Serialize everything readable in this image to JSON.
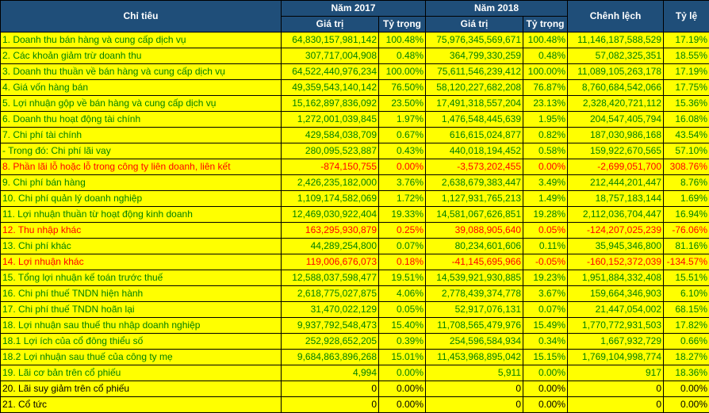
{
  "header": {
    "chi_tieu": "Chỉ tiêu",
    "year_2017": "Năm 2017",
    "year_2018": "Năm 2018",
    "chenh_lech": "Chênh lệch",
    "ty_le": "Tỷ lệ",
    "gia_tri": "Giá trị",
    "ty_trong": "Tỷ trọng"
  },
  "rows": [
    {
      "label": "1. Doanh thu bán hàng và cung cấp dịch vụ",
      "v2017": "64,830,157,981,142",
      "t2017": "100.48%",
      "v2018": "75,976,345,569,671",
      "t2018": "100.48%",
      "diff": "11,146,187,588,529",
      "rate": "17.19%",
      "color": "green"
    },
    {
      "label": "2. Các khoản giảm trừ doanh thu",
      "v2017": "307,717,004,908",
      "t2017": "0.48%",
      "v2018": "364,799,330,259",
      "t2018": "0.48%",
      "diff": "57,082,325,351",
      "rate": "18.55%",
      "color": "green"
    },
    {
      "label": "3. Doanh thu thuần về bán hàng và cung cấp dịch vụ",
      "v2017": "64,522,440,976,234",
      "t2017": "100.00%",
      "v2018": "75,611,546,239,412",
      "t2018": "100.00%",
      "diff": "11,089,105,263,178",
      "rate": "17.19%",
      "color": "green"
    },
    {
      "label": "4. Giá vốn hàng bán",
      "v2017": "49,359,543,140,142",
      "t2017": "76.50%",
      "v2018": "58,120,227,682,208",
      "t2018": "76.87%",
      "diff": "8,760,684,542,066",
      "rate": "17.75%",
      "color": "green"
    },
    {
      "label": "5. Lợi nhuận gộp về bán hàng và cung cấp dịch vụ",
      "v2017": "15,162,897,836,092",
      "t2017": "23.50%",
      "v2018": "17,491,318,557,204",
      "t2018": "23.13%",
      "diff": "2,328,420,721,112",
      "rate": "15.36%",
      "color": "green"
    },
    {
      "label": "6. Doanh thu hoạt động tài chính",
      "v2017": "1,272,001,039,845",
      "t2017": "1.97%",
      "v2018": "1,476,548,445,639",
      "t2018": "1.95%",
      "diff": "204,547,405,794",
      "rate": "16.08%",
      "color": "green"
    },
    {
      "label": "7. Chi phí tài chính",
      "v2017": "429,584,038,709",
      "t2017": "0.67%",
      "v2018": "616,615,024,877",
      "t2018": "0.82%",
      "diff": "187,030,986,168",
      "rate": "43.54%",
      "color": "green"
    },
    {
      "label": " - Trong đó: Chi phí lãi vay",
      "v2017": "280,095,523,887",
      "t2017": "0.43%",
      "v2018": "440,018,194,452",
      "t2018": "0.58%",
      "diff": "159,922,670,565",
      "rate": "57.10%",
      "color": "green"
    },
    {
      "label": "8. Phần lãi lỗ hoặc lỗ trong công ty liên doanh, liên kết",
      "v2017": "-874,150,755",
      "t2017": "0.00%",
      "v2018": "-3,573,202,455",
      "t2018": "0.00%",
      "diff": "-2,699,051,700",
      "rate": "308.76%",
      "color": "red"
    },
    {
      "label": "9. Chi phí bán hàng",
      "v2017": "2,426,235,182,000",
      "t2017": "3.76%",
      "v2018": "2,638,679,383,447",
      "t2018": "3.49%",
      "diff": "212,444,201,447",
      "rate": "8.76%",
      "color": "green"
    },
    {
      "label": "10. Chi phí quản lý doanh nghiệp",
      "v2017": "1,109,174,582,069",
      "t2017": "1.72%",
      "v2018": "1,127,931,765,213",
      "t2018": "1.49%",
      "diff": "18,757,183,144",
      "rate": "1.69%",
      "color": "green"
    },
    {
      "label": "11. Lợi nhuận thuần từ hoạt động kinh doanh",
      "v2017": "12,469,030,922,404",
      "t2017": "19.33%",
      "v2018": "14,581,067,626,851",
      "t2018": "19.28%",
      "diff": "2,112,036,704,447",
      "rate": "16.94%",
      "color": "green"
    },
    {
      "label": "12. Thu nhập khác",
      "v2017": "163,295,930,879",
      "t2017": "0.25%",
      "v2018": "39,088,905,640",
      "t2018": "0.05%",
      "diff": "-124,207,025,239",
      "rate": "-76.06%",
      "color": "red"
    },
    {
      "label": "13. Chi phí khác",
      "v2017": "44,289,254,800",
      "t2017": "0.07%",
      "v2018": "80,234,601,606",
      "t2018": "0.11%",
      "diff": "35,945,346,800",
      "rate": "81.16%",
      "color": "green"
    },
    {
      "label": "14. Lợi nhuận khác",
      "v2017": "119,006,676,073",
      "t2017": "0.18%",
      "v2018": "-41,145,695,966",
      "t2018": "-0.05%",
      "diff": "-160,152,372,039",
      "rate": "-134.57%",
      "color": "red"
    },
    {
      "label": "15. Tổng lợi nhuận kế toán trước thuế",
      "v2017": "12,588,037,598,477",
      "t2017": "19.51%",
      "v2018": "14,539,921,930,885",
      "t2018": "19.23%",
      "diff": "1,951,884,332,408",
      "rate": "15.51%",
      "color": "green"
    },
    {
      "label": "16. Chi phí thuế TNDN hiện hành",
      "v2017": "2,618,775,027,875",
      "t2017": "4.06%",
      "v2018": "2,778,439,374,778",
      "t2018": "3.67%",
      "diff": "159,664,346,903",
      "rate": "6.10%",
      "color": "green"
    },
    {
      "label": "17. Chi phí thuế TNDN hoãn lại",
      "v2017": "31,470,022,129",
      "t2017": "0.05%",
      "v2018": "52,917,076,131",
      "t2018": "0.07%",
      "diff": "21,447,054,002",
      "rate": "68.15%",
      "color": "green"
    },
    {
      "label": "18. Lợi nhuận sau thuế thu nhập doanh nghiệp",
      "v2017": "9,937,792,548,473",
      "t2017": "15.40%",
      "v2018": "11,708,565,479,976",
      "t2018": "15.49%",
      "diff": "1,770,772,931,503",
      "rate": "17.82%",
      "color": "green"
    },
    {
      "label": "18.1 Lợi ích của cổ đông thiểu số",
      "v2017": "252,928,652,205",
      "t2017": "0.39%",
      "v2018": "254,596,584,934",
      "t2018": "0.34%",
      "diff": "1,667,932,729",
      "rate": "0.66%",
      "color": "green"
    },
    {
      "label": "18.2 Lợi nhuận sau thuế của công ty mẹ",
      "v2017": "9,684,863,896,268",
      "t2017": "15.01%",
      "v2018": "11,453,968,895,042",
      "t2018": "15.15%",
      "diff": "1,769,104,998,774",
      "rate": "18.27%",
      "color": "green"
    },
    {
      "label": "19. Lãi cơ bản trên cổ phiếu",
      "v2017": "4,994",
      "t2017": "0.00%",
      "v2018": "5,911",
      "t2018": "0.00%",
      "diff": "917",
      "rate": "18.36%",
      "color": "green"
    },
    {
      "label": "20. Lãi suy giảm trên cổ phiếu",
      "v2017": "0",
      "t2017": "0.00%",
      "v2018": "0",
      "t2018": "0.00%",
      "diff": "0",
      "rate": "0.00%",
      "color": "black"
    },
    {
      "label": "21. Cổ tức",
      "v2017": "0",
      "t2017": "0.00%",
      "v2018": "0",
      "t2018": "0.00%",
      "diff": "0",
      "rate": "0.00%",
      "color": "black"
    }
  ],
  "colors": {
    "header_bg": "#1F4E79",
    "header_text": "#ffffff",
    "highlight": "#FFFF00",
    "positive_text": "#008000",
    "negative_text": "#FF0000"
  }
}
